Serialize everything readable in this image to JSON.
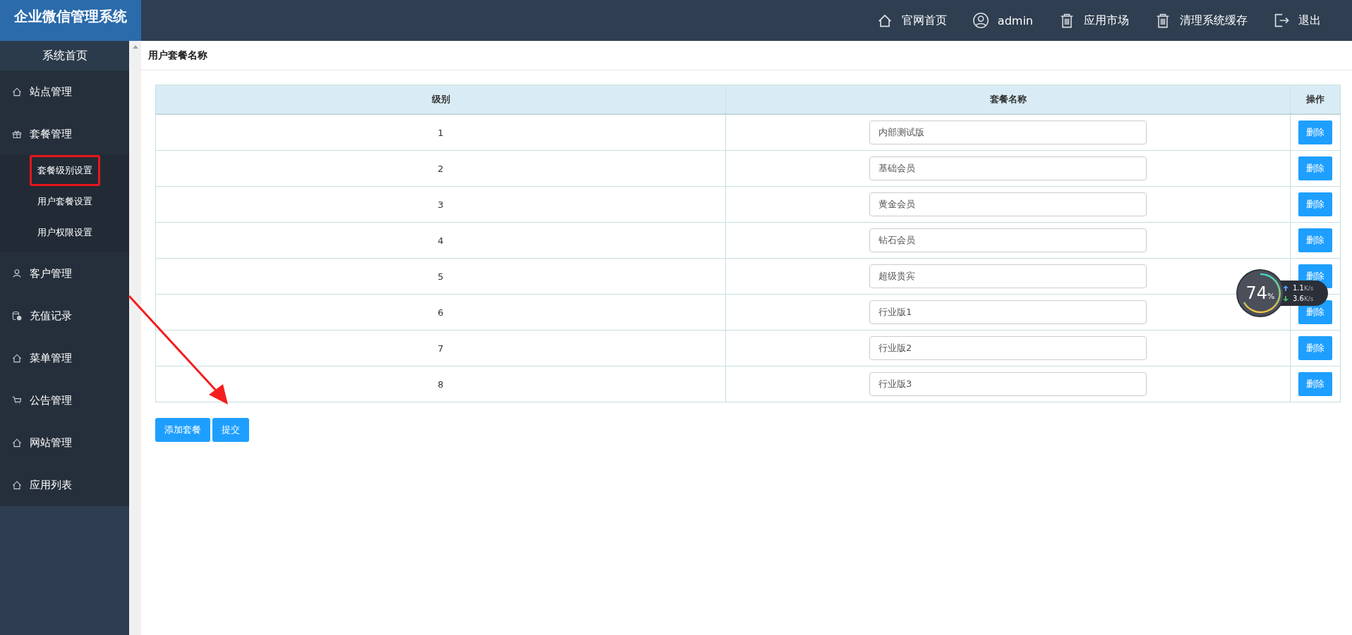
{
  "header": {
    "title": "企业微信管理系统",
    "nav": [
      {
        "label": "官网首页"
      },
      {
        "label": "admin"
      },
      {
        "label": "应用市场"
      },
      {
        "label": "清理系统缓存"
      },
      {
        "label": "退出"
      }
    ]
  },
  "sidebar": {
    "home": "系统首页",
    "items": [
      {
        "label": "站点管理"
      },
      {
        "label": "套餐管理",
        "children": [
          {
            "label": "套餐级别设置",
            "highlighted": true
          },
          {
            "label": "用户套餐设置",
            "highlighted": false
          },
          {
            "label": "用户权限设置",
            "highlighted": false
          }
        ]
      },
      {
        "label": "客户管理"
      },
      {
        "label": "充值记录"
      },
      {
        "label": "菜单管理"
      },
      {
        "label": "公告管理"
      },
      {
        "label": "网站管理"
      },
      {
        "label": "应用列表"
      }
    ]
  },
  "page": {
    "title": "用户套餐名称",
    "table": {
      "columns": [
        "级别",
        "套餐名称",
        "操作"
      ],
      "rows": [
        {
          "level": "1",
          "name": "内部测试版",
          "action": "删除"
        },
        {
          "level": "2",
          "name": "基础会员",
          "action": "删除"
        },
        {
          "level": "3",
          "name": "黄金会员",
          "action": "删除"
        },
        {
          "level": "4",
          "name": "钻石会员",
          "action": "删除"
        },
        {
          "level": "5",
          "name": "超级贵宾",
          "action": "删除"
        },
        {
          "level": "6",
          "name": "行业版1",
          "action": "删除"
        },
        {
          "level": "7",
          "name": "行业版2",
          "action": "删除"
        },
        {
          "level": "8",
          "name": "行业版3",
          "action": "删除"
        }
      ]
    },
    "buttons": [
      "添加套餐",
      "提交"
    ]
  },
  "net_widget": {
    "percent": "74",
    "unit": "%",
    "upload": "1.1",
    "upload_unit": "K/s",
    "download": "3.6",
    "download_unit": "K/s"
  },
  "annotation": {
    "arrow": true
  }
}
